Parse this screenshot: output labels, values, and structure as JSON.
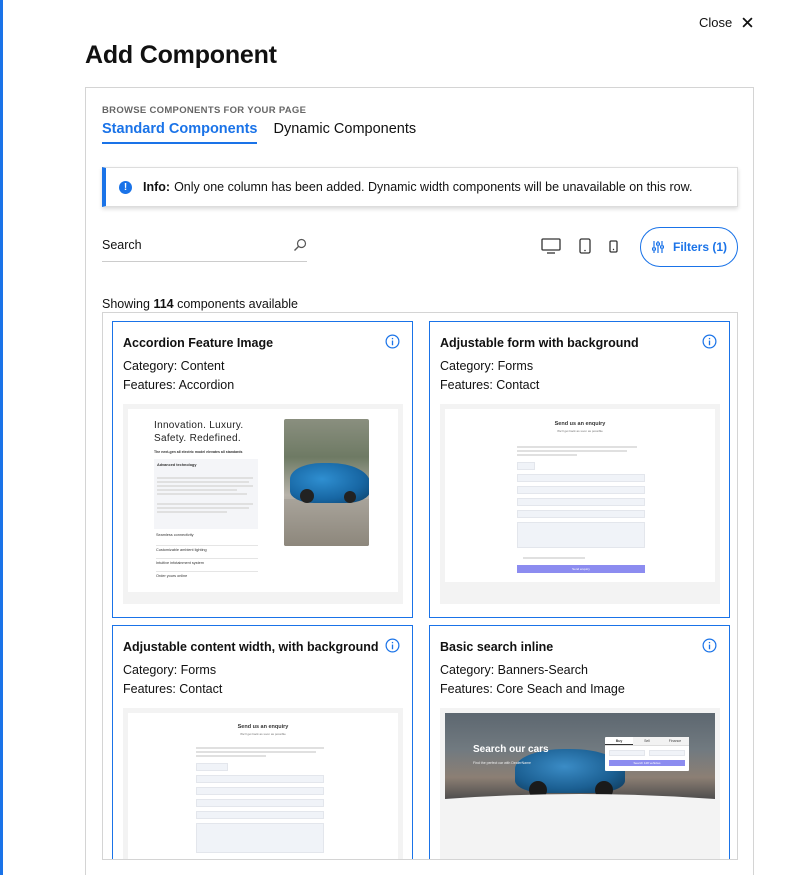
{
  "dialog": {
    "title": "Add Component",
    "close_label": "Close"
  },
  "browser": {
    "eyebrow": "BROWSE COMPONENTS FOR YOUR PAGE",
    "tabs": [
      {
        "label": "Standard Components",
        "active": true
      },
      {
        "label": "Dynamic Components",
        "active": false
      }
    ]
  },
  "alert": {
    "prefix": "Info:",
    "message": "Only one column has been added. Dynamic width components will be unavailable on this row."
  },
  "search": {
    "placeholder": "Search",
    "value": ""
  },
  "filters": {
    "label": "Filters (1)"
  },
  "results": {
    "prefix": "Showing",
    "count": "114",
    "suffix": "components available"
  },
  "cards": [
    {
      "title": "Accordion Feature Image",
      "category": "Category: Content",
      "features": "Features: Accordion",
      "preview": {
        "headline_1": "Innovation. Luxury.",
        "headline_2": "Safety. Redefined.",
        "sub": "The next-gen all electric model elevates all standards",
        "accordion_open": "Advanced technology",
        "items": [
          "Seamless connectivity",
          "Customizable ambient lighting",
          "Intuitive infotainment system",
          "Order yours online"
        ]
      }
    },
    {
      "title": "Adjustable form with background",
      "category": "Category: Forms",
      "features": "Features: Contact",
      "preview": {
        "form_title": "Send us an enquiry",
        "form_sub": "We'll get back as soon as possible",
        "submit": "Send enquiry"
      }
    },
    {
      "title": "Adjustable content width, with background",
      "category": "Category: Forms",
      "features": "Features: Contact",
      "preview": {
        "form_title": "Send us an enquiry",
        "form_sub": "We'll get back as soon as possible"
      }
    },
    {
      "title": "Basic search inline",
      "category": "Category: Banners-Search",
      "features": "Features: Core Seach and Image",
      "preview": {
        "banner_title": "Search our cars",
        "banner_sub": "Find the perfect car with DealerName",
        "tabs": [
          "Buy",
          "Sell",
          "Finance"
        ],
        "button": "Search 128 vehicles"
      }
    }
  ],
  "colors": {
    "accent": "#1a73e8",
    "form_button": "#8c8cf0"
  }
}
